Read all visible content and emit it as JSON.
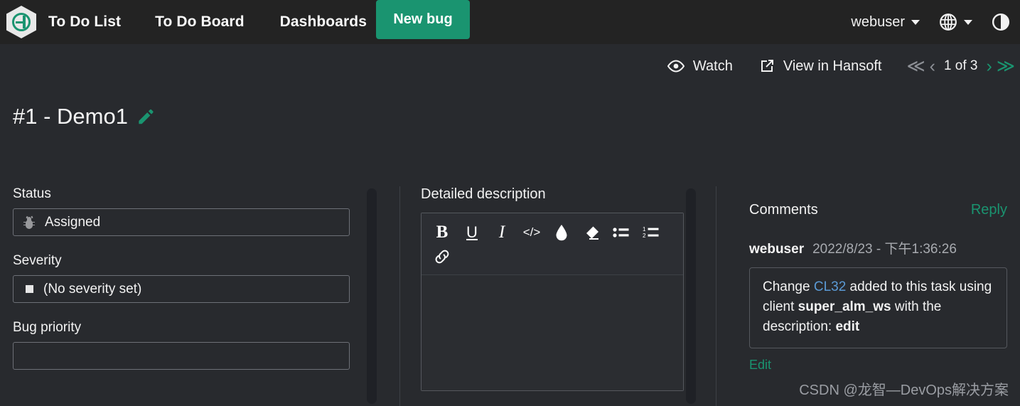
{
  "brand": {
    "logo_icon": "hansoft-hexagon-logo",
    "accent": "#1a9470"
  },
  "topnav": {
    "links": [
      {
        "label": "To Do List"
      },
      {
        "label": "To Do Board"
      },
      {
        "label": "Dashboards"
      }
    ],
    "primary_button": "New bug",
    "user": "webuser",
    "language_icon": "globe-icon",
    "theme_icon": "contrast-half-circle-icon"
  },
  "subbar": {
    "watch": "Watch",
    "watch_icon": "eye-icon",
    "view_external": "View in Hansoft",
    "view_external_icon": "external-link-icon",
    "pager": {
      "first": "≪",
      "prev": "‹",
      "label": "1 of 3",
      "next": "›",
      "last": "≫"
    }
  },
  "title": {
    "text": "#1 - Demo1",
    "edit_icon": "pencil-icon"
  },
  "left_panel": {
    "fields": [
      {
        "label": "Status",
        "value": "Assigned",
        "icon": "bug-icon"
      },
      {
        "label": "Severity",
        "value": "(No severity set)",
        "icon": "square-icon"
      },
      {
        "label": "Bug priority",
        "value": "",
        "icon": ""
      }
    ]
  },
  "description": {
    "label": "Detailed description",
    "body": "",
    "toolbar": [
      {
        "name": "bold-button",
        "glyph": "B"
      },
      {
        "name": "underline-button",
        "glyph": "U"
      },
      {
        "name": "italic-button",
        "glyph": "I"
      },
      {
        "name": "code-button",
        "glyph": "</>"
      },
      {
        "name": "text-color-button",
        "glyph": "⬤"
      },
      {
        "name": "eraser-button",
        "glyph": "◢"
      },
      {
        "name": "bulleted-list-button",
        "glyph": "☰"
      },
      {
        "name": "numbered-list-button",
        "glyph": "☰"
      },
      {
        "name": "link-button",
        "glyph": "⚭"
      }
    ]
  },
  "comments": {
    "title": "Comments",
    "reply_label": "Reply",
    "items": [
      {
        "author": "webuser",
        "date": "2022/8/23 - 下午1:36:26",
        "text_1": "Change ",
        "link": "CL32",
        "text_2": " added to this task using client ",
        "bold_1": "super_alm_ws",
        "text_3": " with the description: ",
        "bold_2": "edit",
        "edit_label": "Edit"
      }
    ]
  },
  "watermark": "CSDN @龙智—DevOps解决方案"
}
